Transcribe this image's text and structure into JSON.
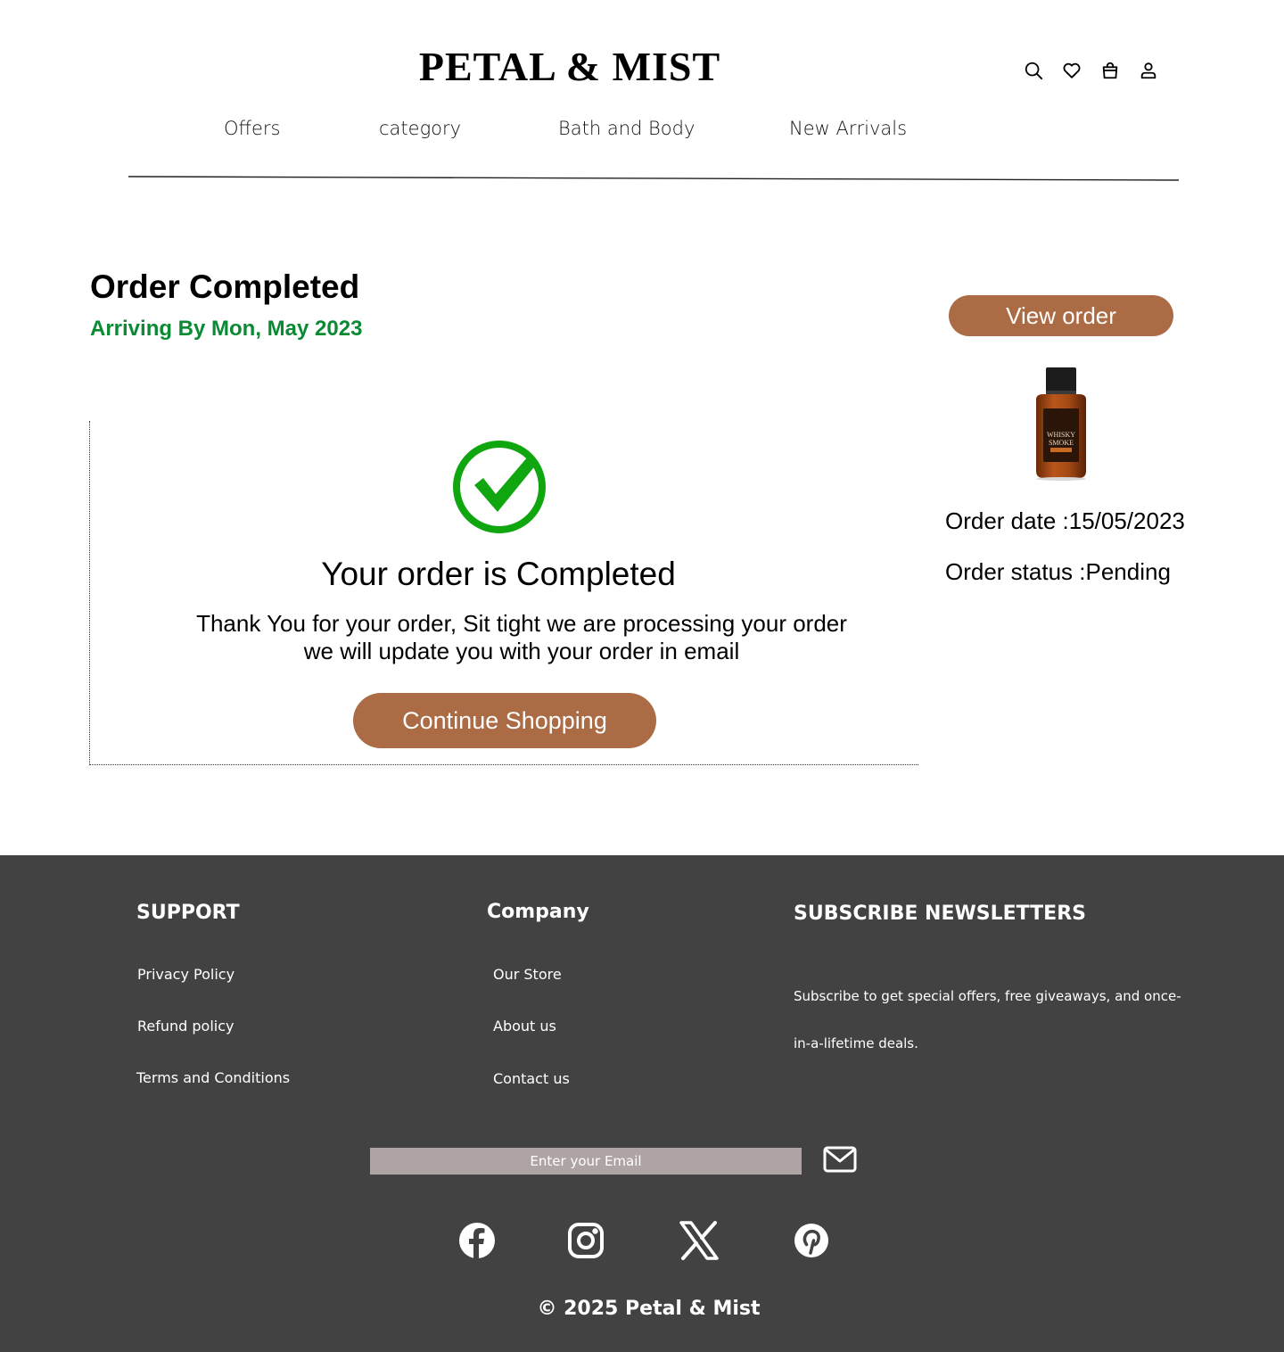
{
  "header": {
    "brand": "PETAL & MIST",
    "icons": [
      "search-icon",
      "heart-icon",
      "shopping-bag-icon",
      "user-icon"
    ],
    "nav": [
      {
        "label": "Offers"
      },
      {
        "label": "category"
      },
      {
        "label": "Bath and Body"
      },
      {
        "label": "New Arrivals"
      }
    ]
  },
  "order": {
    "title": "Order Completed",
    "arrival": "Arriving By Mon, May 2023",
    "confirmation_heading": "Your order is Completed",
    "confirmation_line1": "Thank You for your order, Sit tight we are processing your order",
    "confirmation_line2": "we will update you with your order in email",
    "continue_label": "Continue Shopping",
    "view_order_label": "View order",
    "order_date": "Order date :15/05/2023",
    "order_status": "Order status :Pending",
    "product_label_top": "WHISKY",
    "product_label_bottom": "SMOKE"
  },
  "colors": {
    "accent": "#ab6b44",
    "success": "#0b8a34",
    "check": "#10a60f",
    "footer_bg": "#424242",
    "email_bg": "#ada4a3"
  },
  "footer": {
    "support": {
      "heading": "SUPPORT",
      "links": [
        "Privacy Policy",
        "Refund policy",
        "Terms and Conditions"
      ]
    },
    "company": {
      "heading": "Company",
      "links": [
        "Our Store",
        "About us",
        "Contact us"
      ]
    },
    "newsletter": {
      "heading": "SUBSCRIBE NEWSLETTERS",
      "description": "Subscribe to get special offers, free giveaways, and once-in-a-lifetime deals.",
      "email_placeholder": "Enter your Email"
    },
    "social": [
      "facebook-icon",
      "instagram-icon",
      "x-icon",
      "pinterest-icon"
    ],
    "copyright": "© 2025  Petal & Mist"
  }
}
